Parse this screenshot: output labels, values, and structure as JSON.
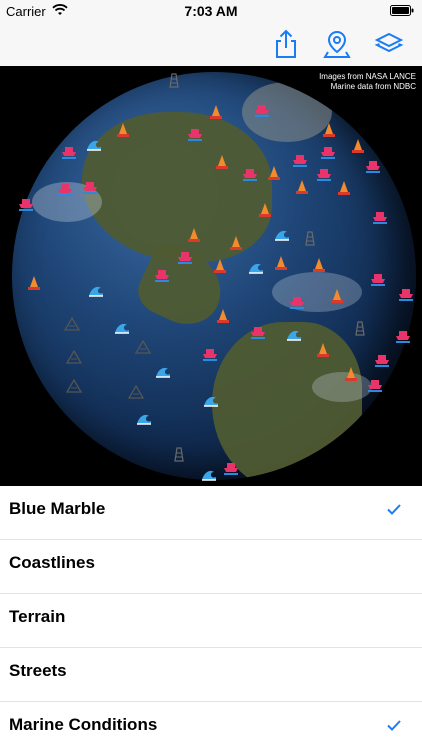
{
  "status": {
    "carrier": "Carrier",
    "time": "7:03 AM"
  },
  "toolbar": {
    "icons": [
      "share-icon",
      "location-pin-icon",
      "layers-icon"
    ]
  },
  "map": {
    "credit_line1": "Images from NASA LANCE",
    "credit_line2": "Marine data from NDBC"
  },
  "layers": [
    {
      "label": "Blue Marble",
      "checked": true
    },
    {
      "label": "Coastlines",
      "checked": false
    },
    {
      "label": "Terrain",
      "checked": false
    },
    {
      "label": "Streets",
      "checked": false
    },
    {
      "label": "Marine Conditions",
      "checked": true
    }
  ],
  "colors": {
    "accent": "#1a7cf5",
    "toolbar_icon": "#1a7cf5"
  }
}
